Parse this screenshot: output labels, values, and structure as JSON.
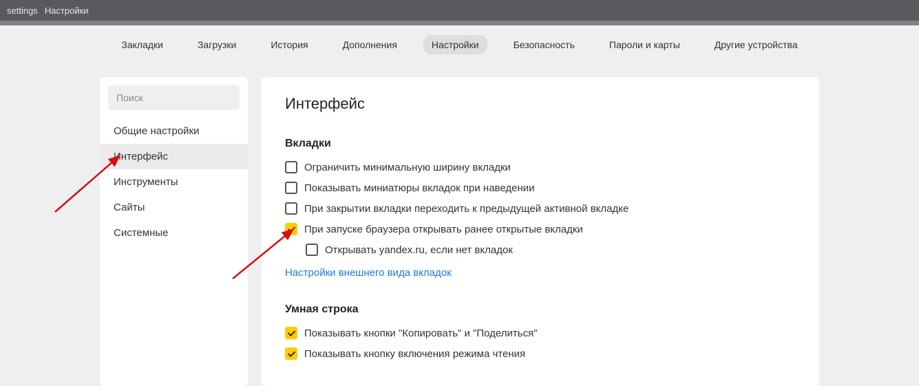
{
  "titlebar": {
    "left": "settings",
    "right": "Настройки"
  },
  "nav": {
    "items": [
      {
        "label": "Закладки"
      },
      {
        "label": "Загрузки"
      },
      {
        "label": "История"
      },
      {
        "label": "Дополнения"
      },
      {
        "label": "Настройки"
      },
      {
        "label": "Безопасность"
      },
      {
        "label": "Пароли и карты"
      },
      {
        "label": "Другие устройства"
      }
    ],
    "active": 4
  },
  "sidebar": {
    "search_placeholder": "Поиск",
    "items": [
      {
        "label": "Общие настройки"
      },
      {
        "label": "Интерфейс"
      },
      {
        "label": "Инструменты"
      },
      {
        "label": "Сайты"
      },
      {
        "label": "Системные"
      }
    ],
    "active": 1
  },
  "main": {
    "heading": "Интерфейс",
    "section1": {
      "title": "Вкладки",
      "opt1": {
        "label": "Ограничить минимальную ширину вкладки",
        "checked": false
      },
      "opt2": {
        "label": "Показывать миниатюры вкладок при наведении",
        "checked": false
      },
      "opt3": {
        "label": "При закрытии вкладки переходить к предыдущей активной вкладке",
        "checked": false
      },
      "opt4": {
        "label": "При запуске браузера открывать ранее открытые вкладки",
        "checked": true
      },
      "opt4sub": {
        "label": "Открывать yandex.ru, если нет вкладок",
        "checked": false
      },
      "link": "Настройки внешнего вида вкладок"
    },
    "section2": {
      "title": "Умная строка",
      "opt1": {
        "label": "Показывать кнопки \"Копировать\" и \"Поделиться\"",
        "checked": true
      },
      "opt2": {
        "label": "Показывать кнопку включения режима чтения",
        "checked": true
      }
    }
  },
  "colors": {
    "accent": "#ffcc00",
    "link": "#2277dd",
    "arrow": "#d41010"
  }
}
